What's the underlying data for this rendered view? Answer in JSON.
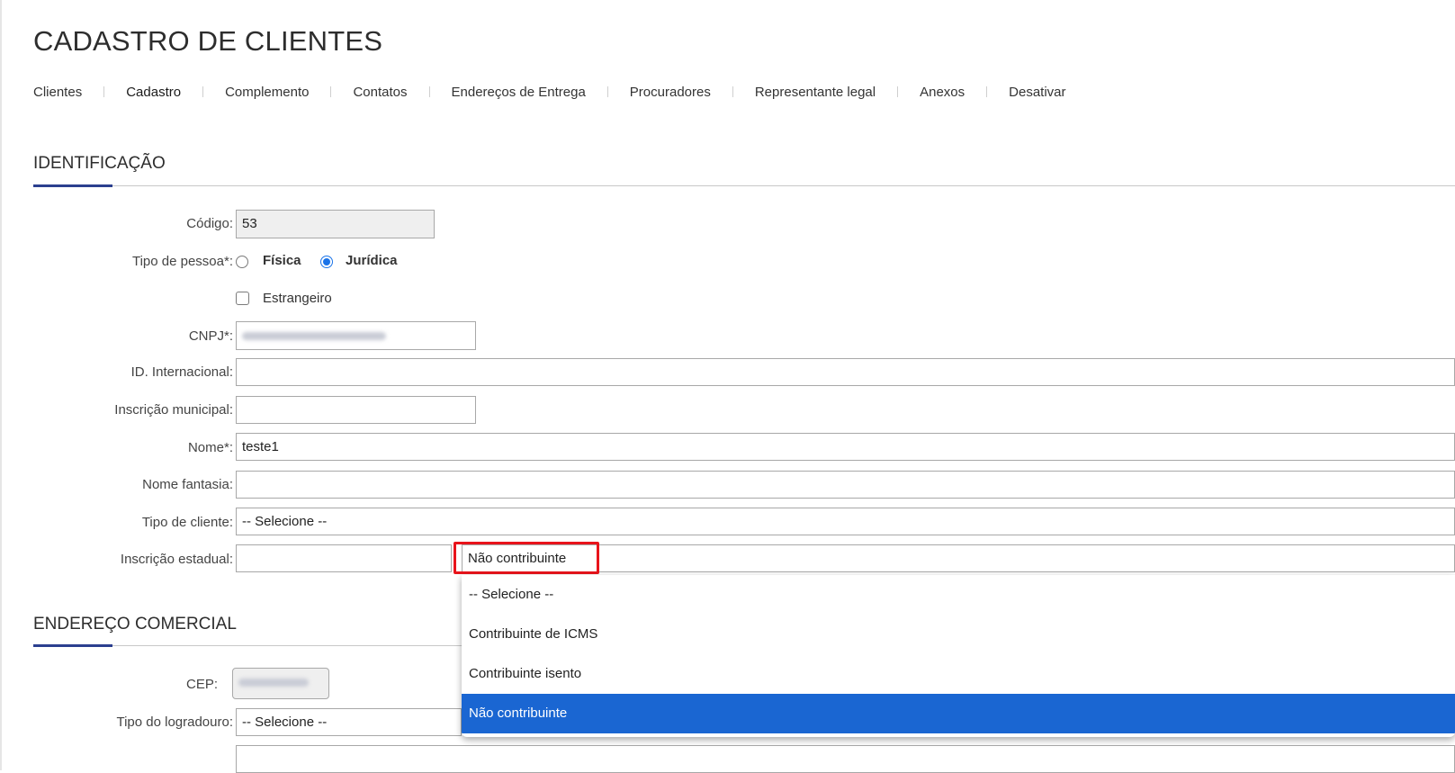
{
  "page": {
    "title": "CADASTRO DE CLIENTES"
  },
  "tabs": [
    "Clientes",
    "Cadastro",
    "Complemento",
    "Contatos",
    "Endereços de Entrega",
    "Procuradores",
    "Representante legal",
    "Anexos",
    "Desativar"
  ],
  "active_tab": "Cadastro",
  "sections": {
    "identificacao": "IDENTIFICAÇÃO",
    "endereco": "ENDEREÇO COMERCIAL"
  },
  "form": {
    "codigo": {
      "label": "Código:",
      "value": "53"
    },
    "tipo_pessoa": {
      "label": "Tipo de pessoa*:",
      "options": [
        "Física",
        "Jurídica"
      ],
      "selected": "Jurídica"
    },
    "estrangeiro": {
      "label": "Estrangeiro",
      "checked": false
    },
    "cnpj": {
      "label": "CNPJ*:",
      "value_redacted": true
    },
    "id_internacional": {
      "label": "ID. Internacional:",
      "value": ""
    },
    "inscricao_municipal": {
      "label": "Inscrição municipal:",
      "value": ""
    },
    "nome": {
      "label": "Nome*:",
      "value": "teste1"
    },
    "nome_fantasia": {
      "label": "Nome fantasia:",
      "value": ""
    },
    "tipo_cliente": {
      "label": "Tipo de cliente:",
      "value": "-- Selecione --"
    },
    "inscricao_estadual": {
      "label": "Inscrição estadual:",
      "value": "",
      "contribuinte_value": "Não contribuinte"
    },
    "cep": {
      "label": "CEP:",
      "value_redacted": true
    },
    "tipo_logradouro": {
      "label": "Tipo do logradouro:",
      "value": "-- Selecione --"
    }
  },
  "dropdown": {
    "options": [
      "-- Selecione --",
      "Contribuinte de ICMS",
      "Contribuinte isento",
      "Não contribuinte"
    ],
    "selected": "Não contribuinte"
  },
  "colors": {
    "accent": "#2b3f8f",
    "selection": "#1a66d2",
    "highlight": "#e8141b"
  }
}
